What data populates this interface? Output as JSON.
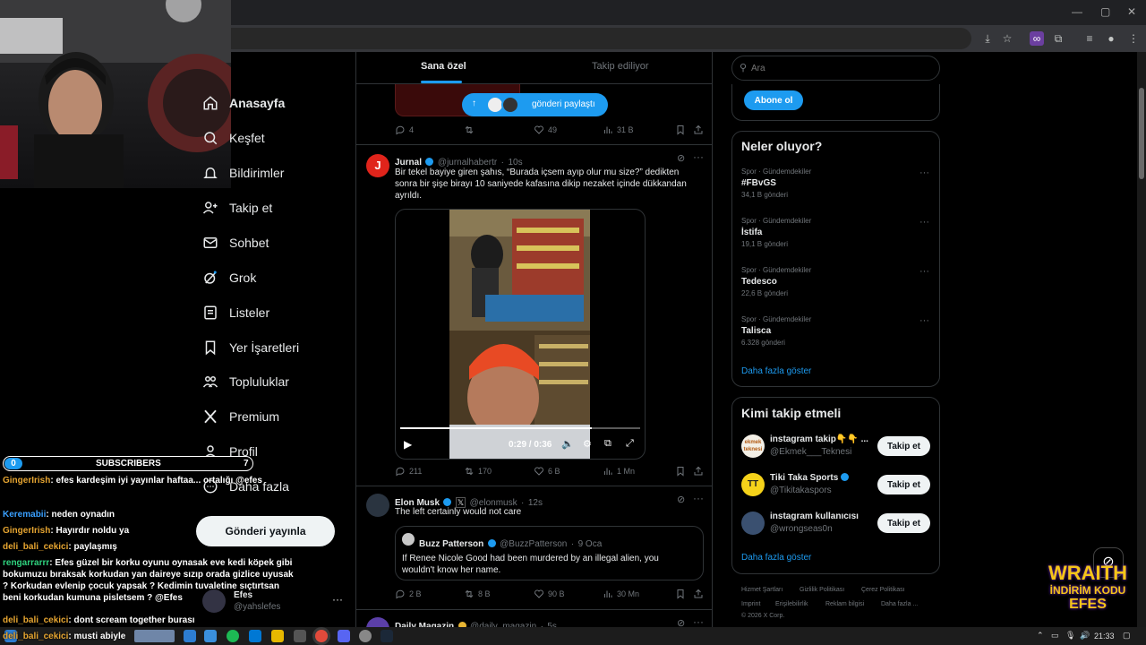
{
  "nav": {
    "items": [
      {
        "label": "Anasayfa",
        "icon": "home-icon"
      },
      {
        "label": "Keşfet",
        "icon": "explore-icon"
      },
      {
        "label": "Bildirimler",
        "icon": "bell-icon"
      },
      {
        "label": "Takip et",
        "icon": "add-person-icon"
      },
      {
        "label": "Sohbet",
        "icon": "mail-icon"
      },
      {
        "label": "Grok",
        "icon": "grok-icon"
      },
      {
        "label": "Listeler",
        "icon": "list-icon"
      },
      {
        "label": "Yer İşaretleri",
        "icon": "bookmark-icon"
      },
      {
        "label": "Topluluklar",
        "icon": "communities-icon"
      },
      {
        "label": "Premium",
        "icon": "x-logo-icon"
      },
      {
        "label": "Profil",
        "icon": "person-icon"
      },
      {
        "label": "Daha fazla",
        "icon": "more-icon"
      }
    ],
    "post_button": "Gönderi yayınla",
    "account_name": "Efes",
    "account_handle": "@yahslefes"
  },
  "timeline": {
    "tabs": [
      "Sana özel",
      "Takip ediliyor"
    ],
    "new_posts_pill": "gönderi paylaştı",
    "top_tweet_stats": {
      "replies": "4",
      "likes": "49",
      "views": "31 B"
    },
    "tweets": [
      {
        "name": "Jurnal",
        "handle": "@jurnalhabertr",
        "time": "10s",
        "avatar_letter": "J",
        "text": "Bir tekel bayiye giren şahıs, “Burada içsem ayıp olur mu size?” dedikten sonra bir şişe birayı 10 saniyede kafasına dikip nezaket içinde dükkandan ayrıldı.",
        "video_time": "0:29 / 0:36",
        "video_progress": 0.8,
        "stats": {
          "replies": "211",
          "reposts": "170",
          "likes": "6 B",
          "views": "1 Mn"
        }
      },
      {
        "name": "Elon Musk",
        "handle": "@elonmusk",
        "time": "12s",
        "text": "The left certainly would not care",
        "quote": {
          "name": "Buzz Patterson",
          "handle": "@BuzzPatterson",
          "time": "9 Oca",
          "text": "If Renee Nicole Good had been murdered by an illegal alien, you wouldn't know her name."
        },
        "stats": {
          "replies": "2 B",
          "reposts": "8 B",
          "likes": "90 B",
          "views": "30 Mn"
        }
      },
      {
        "name": "Daily Magazin",
        "handle": "@daily_magazin",
        "time": "5s"
      }
    ]
  },
  "search": {
    "placeholder": "Ara"
  },
  "subscribe_button": "Abone ol",
  "trends": {
    "title": "Neler oluyor?",
    "items": [
      {
        "meta": "Spor · Gündemdekiler",
        "name": "#FBvGS",
        "count": "34,1 B gönderi"
      },
      {
        "meta": "Spor · Gündemdekiler",
        "name": "İstifa",
        "count": "19,1 B gönderi"
      },
      {
        "meta": "Spor · Gündemdekiler",
        "name": "Tedesco",
        "count": "22,6 B gönderi"
      },
      {
        "meta": "Spor · Gündemdekiler",
        "name": "Talisca",
        "count": "6.328 gönderi"
      }
    ],
    "show_more": "Daha fazla göster"
  },
  "who_to_follow": {
    "title": "Kimi takip etmeli",
    "items": [
      {
        "name": "instagram takip👇👇 ...",
        "handle": "@Ekmek___Teknesi",
        "button": "Takip et"
      },
      {
        "name": "Tiki Taka Sports",
        "handle": "@Tikitakaspors",
        "button": "Takip et"
      },
      {
        "name": "instagram kullanıcısı",
        "handle": "@wrongseas0n",
        "button": "Takip et"
      }
    ],
    "show_more": "Daha fazla göster"
  },
  "footer": {
    "links": [
      "Hizmet Şartları",
      "Gizlilik Politikası",
      "Çerez Politikası",
      "Imprint",
      "Erişilebilirlik",
      "Reklam bilgisi",
      "Daha fazla ..."
    ],
    "copyright": "© 2026 X Corp."
  },
  "stream_overlay": {
    "subscribers_label": "SUBSCRIBERS",
    "subscribers_count": "0",
    "subscribers_goal": "7",
    "chat": [
      {
        "user": "GingerIrish",
        "text": ": efes kardeşim iyi yayınlar haftaa... ortalığı @efes"
      },
      {
        "user": "Keremabii",
        "text": ": neden oynadın"
      },
      {
        "user": "GingerIrish",
        "text": ": Hayırdır noldu ya"
      },
      {
        "user": "deli_bali_cekici",
        "text": ": paylaşmış"
      },
      {
        "user": "rengarrarrr",
        "text": ": Efes güzel bir korku oyunu oynasak eve kedi köpek gibi bokumuzu bıraksak korkudan yan daireye sızıp orada gizlice uyusak ? Korkudan evlenip çocuk yapsak ? Kedimin tuvaletine sıçtırtsan beni korkudan kumuna pisletsem ? @Efes"
      },
      {
        "user": "deli_bali_cekici",
        "text": ": dont scream together burası"
      },
      {
        "user": "deli_bali_cekici",
        "text": ": musti abiyle"
      }
    ],
    "sponsor": {
      "line1": "WRAITH",
      "line2": "İNDİRİM KODU",
      "line3": "EFES"
    }
  },
  "taskbar": {
    "time": "21:33"
  },
  "colors": {
    "accent": "#1d9bf0",
    "background": "#000000",
    "border": "#2f3336",
    "muted": "#71767b"
  }
}
